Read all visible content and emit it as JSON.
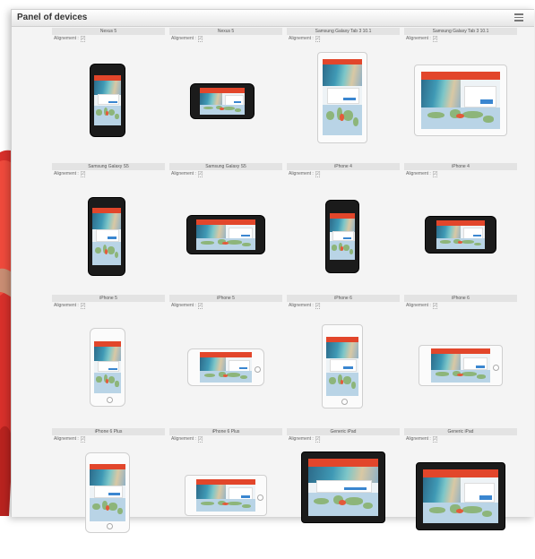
{
  "panel": {
    "title": "Panel of devices",
    "menu_icon": "hamburger-menu-icon"
  },
  "colors": {
    "accent_red": "#e2462b",
    "button_blue": "#3a86d0",
    "map_water": "#b9d4e6"
  },
  "devices": [
    {
      "name": "Nexus 5",
      "align_label": "Alignement :",
      "align_value": "[2]"
    },
    {
      "name": "Nexus 5",
      "align_label": "Alignement :",
      "align_value": "[2]"
    },
    {
      "name": "Samsung Galaxy Tab 3 10.1",
      "align_label": "Alignement :",
      "align_value": "[2]"
    },
    {
      "name": "Samsung Galaxy Tab 3 10.1",
      "align_label": "Alignement :",
      "align_value": "[2]"
    },
    {
      "name": "Samsung Galaxy S5",
      "align_label": "Alignement :",
      "align_value": "[2]"
    },
    {
      "name": "Samsung Galaxy S5",
      "align_label": "Alignement :",
      "align_value": "[2]"
    },
    {
      "name": "iPhone 4",
      "align_label": "Alignement :",
      "align_value": "[2]"
    },
    {
      "name": "iPhone 4",
      "align_label": "Alignement :",
      "align_value": "[2]"
    },
    {
      "name": "iPhone 5",
      "align_label": "Alignement :",
      "align_value": "[2]"
    },
    {
      "name": "iPhone 5",
      "align_label": "Alignement :",
      "align_value": "[2]"
    },
    {
      "name": "iPhone 6",
      "align_label": "Alignement :",
      "align_value": "[2]"
    },
    {
      "name": "iPhone 6",
      "align_label": "Alignement :",
      "align_value": "[2]"
    },
    {
      "name": "iPhone 6 Plus",
      "align_label": "Alignement :",
      "align_value": "[2]"
    },
    {
      "name": "iPhone 6 Plus",
      "align_label": "Alignement :",
      "align_value": "[2]"
    },
    {
      "name": "Generic iPad",
      "align_label": "Alignement :",
      "align_value": "[2]"
    },
    {
      "name": "Generic iPad",
      "align_label": "Alignement :",
      "align_value": "[2]"
    }
  ]
}
